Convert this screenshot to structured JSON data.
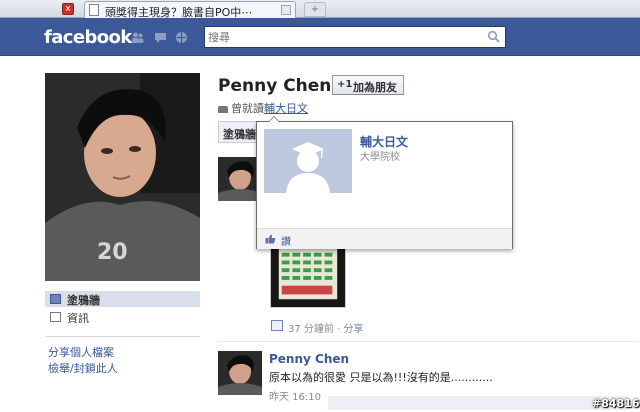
{
  "browser": {
    "tab_title": "頭獎得主現身？臉書自PO中⋯",
    "new_tab_glyph": "+",
    "close_glyph": "x"
  },
  "header": {
    "logo": "facebook",
    "search_placeholder": "搜尋",
    "brand_color": "#3b5998",
    "icons": [
      "friend-requests-icon",
      "messages-icon",
      "notifications-icon",
      "search-icon"
    ]
  },
  "sidebar": {
    "items": [
      {
        "label": "塗鴉牆",
        "icon": "wall-icon"
      },
      {
        "label": "資訊",
        "icon": "info-icon"
      }
    ],
    "links": [
      "分享個人檔案",
      "檢舉/封鎖此人"
    ]
  },
  "profile": {
    "name": "Penny Chen",
    "add_friend_label": "加為朋友",
    "add_friend_icon_text": "+1",
    "education_prefix": "曾就讀",
    "education_school": "輔大日文"
  },
  "wall": {
    "tab_label": "塗鴉牆"
  },
  "hovercard": {
    "name": "輔大日文",
    "subtitle": "大學院校",
    "like_label": "讚"
  },
  "posts": [
    {
      "time": "37 分鐘前",
      "separator": "·",
      "share_label": "分享"
    },
    {
      "author": "Penny Chen",
      "text": "原本以為的很愛 只是以為!!!沒有的是............",
      "time": "昨天 16:10"
    }
  ],
  "watermark": "#84816"
}
